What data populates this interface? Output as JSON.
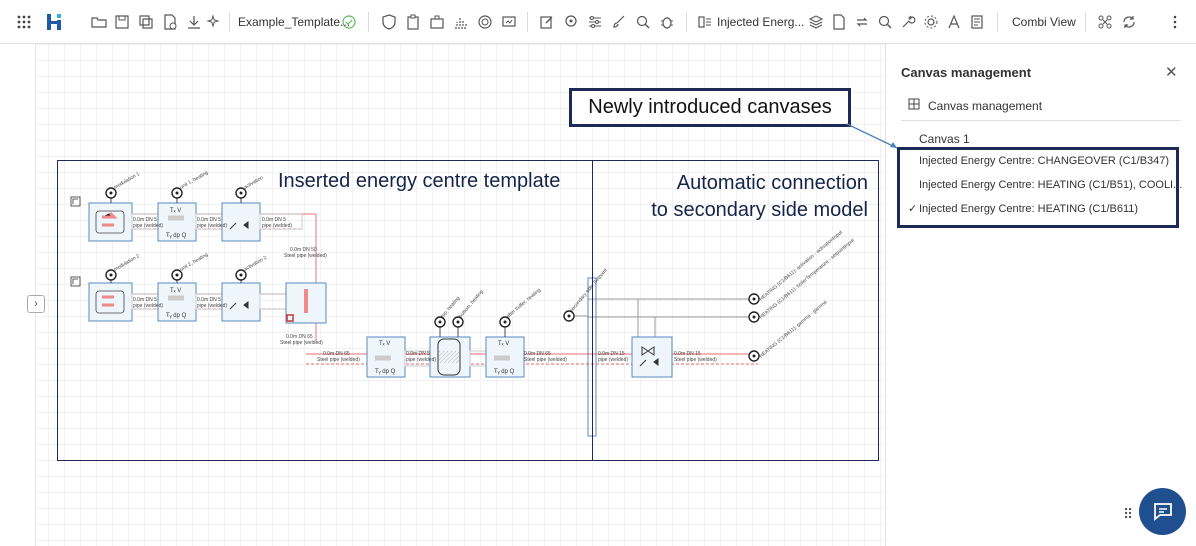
{
  "toolbar": {
    "file_name": "Example_Template...",
    "selected_canvas": "Injected Energ...",
    "view_mode": "Combi View"
  },
  "annotations": {
    "callout": "Newly introduced canvases",
    "template_label": "Inserted energy centre template",
    "connection_label_line1": "Automatic connection",
    "connection_label_line2": "to secondary side model"
  },
  "panel": {
    "title": "Canvas management",
    "section": "Canvas management",
    "canvases": [
      {
        "label": "Canvas 1",
        "checked": false
      },
      {
        "label": "Injected Energy Centre: CHANGEOVER (C1/B347)",
        "checked": false
      },
      {
        "label": "Injected Energy Centre: HEATING (C1/B51), COOLI...",
        "checked": false
      },
      {
        "label": "Injected Energy Centre: HEATING (C1/B611)",
        "checked": true
      }
    ]
  },
  "diagram": {
    "sensor_labels": [
      "modulation 1",
      "unit 1, heating",
      "activation",
      "modulation 2",
      "unit 2, heating",
      "activation 2",
      "top, heating",
      "bottom, heating",
      "after buffer, heating",
      "secondary side, Setpoint"
    ],
    "pipe_labels": [
      "0.0m DN 5",
      "pipe (welded)",
      "0.0m DN 50",
      "Steel pipe (welded)",
      "0.0m DN 65",
      "0.0m DN 15",
      "0.0m DN 65"
    ],
    "output_labels": [
      "HEATING (C1/B611): activation - activationInput",
      "HEATING (C1/B611): boilerTemperature - setpointInput",
      "HEATING (C1/B611): gamma - gamma"
    ],
    "tv_label": "Tₓ V",
    "tdq_label": "Tᵧ dp Q"
  },
  "colors": {
    "brand": "#1e5aa6",
    "annotation": "#1c2a55",
    "fab": "#1f4f8f",
    "pipe_red": "#f08a8a"
  }
}
